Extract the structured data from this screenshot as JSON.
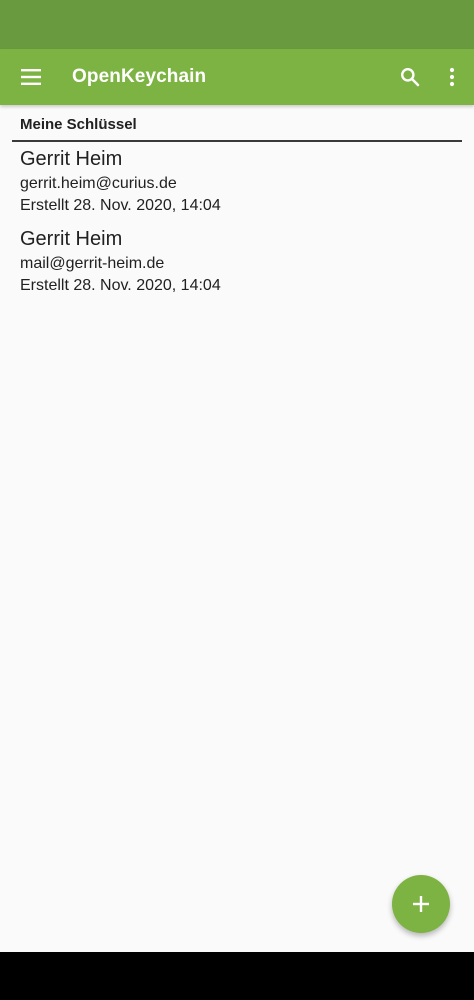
{
  "app_bar": {
    "title": "OpenKeychain",
    "menu_icon": "hamburger-menu-icon",
    "search_icon": "search-icon",
    "more_icon": "more-vertical-icon"
  },
  "section": {
    "title": "Meine Schlüssel"
  },
  "keys": [
    {
      "name": "Gerrit Heim",
      "email": "gerrit.heim@curius.de",
      "created": "Erstellt 28. Nov. 2020, 14:04"
    },
    {
      "name": "Gerrit Heim",
      "email": "mail@gerrit-heim.de",
      "created": "Erstellt 28. Nov. 2020, 14:04"
    }
  ],
  "fab": {
    "icon": "plus-icon"
  },
  "colors": {
    "primary": "#7cb342",
    "status_bar": "#6a9a3f",
    "background": "#fafafa"
  }
}
